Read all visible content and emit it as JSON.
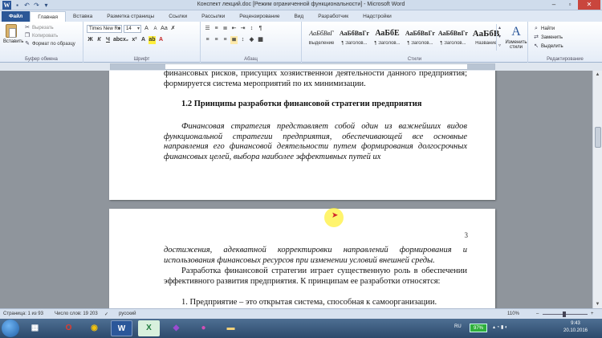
{
  "window": {
    "title": "Конспект лекций.doc [Режим ограниченной функциональности] - Microsoft Word"
  },
  "tabs": [
    "Файл",
    "Главная",
    "Вставка",
    "Разметка страницы",
    "Ссылки",
    "Рассылки",
    "Рецензирование",
    "Вид",
    "Разработчик",
    "Надстройки"
  ],
  "clipboard": {
    "paste": "Вставить",
    "cut": "Вырезать",
    "copy": "Копировать",
    "format_painter": "Формат по образцу",
    "group": "Буфер обмена"
  },
  "font": {
    "name": "Times New Ro",
    "size": "14",
    "group": "Шрифт"
  },
  "paragraph": {
    "group": "Абзац"
  },
  "styles": {
    "items": [
      {
        "sample": "АаБбВвГ",
        "name": "Выделение"
      },
      {
        "sample": "АаБбВвГг",
        "name": "¶ Заголов..."
      },
      {
        "sample": "АаБбЕ",
        "name": "¶ Заголов..."
      },
      {
        "sample": "АаБбВвГг",
        "name": "¶ Заголов..."
      },
      {
        "sample": "АаБбВвГг",
        "name": "¶ Заголов..."
      },
      {
        "sample": "АаБбВ",
        "name": "Название"
      }
    ],
    "change": "Изменить стили",
    "group": "Стили"
  },
  "editing": {
    "find": "Найти",
    "replace": "Заменить",
    "select": "Выделить",
    "group": "Редактирование"
  },
  "document": {
    "page1_top": "финансовых рисков, присущих хозяйственной деятельности данного предприятия; формируется система мероприятий по их минимизации.",
    "heading": "1.2  Принципы разработки финансовой стратегии предприятия",
    "page1_italic": "Финансовая стратегия представляет собой один из важнейших видов функциональной стратегии предприятия, обеспечивающей все основные направления его финансовой деятельности путем формирования долгосрочных финансовых целей, выбора наиболее эффективных путей их",
    "page_number": "3",
    "page2_italic": "достижения, адекватной корректировки направлений формирования и использования финансовых ресурсов при изменении условий внешней среды.",
    "page2_para": "Разработка финансовой стратегии играет существенную роль в обеспечении эффективного развития предприятия. К принципам ее разработки относятся:",
    "list_item": "1.  Предприятие – это открытая система, способная к самоорганизации."
  },
  "status": {
    "page": "Страница: 1 из 93",
    "words": "Число слов: 19 203",
    "language": "русский",
    "zoom": "110%"
  },
  "taskbar": {
    "lang": "RU",
    "battery": "97%",
    "time": "9:43",
    "date": "20.10.2016"
  }
}
